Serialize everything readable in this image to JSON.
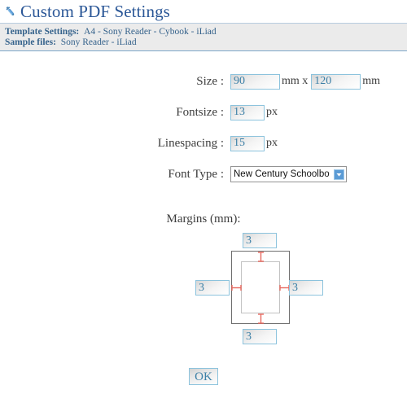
{
  "header": {
    "icon": "wrench-icon",
    "title": "Custom PDF Settings"
  },
  "info": {
    "templates_label": "Template Settings:",
    "templates": [
      "A4",
      "Sony Reader",
      "Cybook",
      "iLiad"
    ],
    "samples_label": "Sample files:",
    "samples": [
      "Sony Reader",
      "iLiad"
    ],
    "separator": " - "
  },
  "form": {
    "size": {
      "label": "Size :",
      "width_value": "90",
      "unit_mid": "mm x",
      "height_value": "120",
      "unit_end": "mm"
    },
    "fontsize": {
      "label": "Fontsize :",
      "value": "13",
      "unit": "px"
    },
    "linespacing": {
      "label": "Linespacing :",
      "value": "15",
      "unit": "px"
    },
    "fonttype": {
      "label": "Font Type :",
      "selected": "New Century Schoolbook",
      "options": [
        "New Century Schoolbook"
      ]
    }
  },
  "margins": {
    "title": "Margins (mm):",
    "top": "3",
    "right": "3",
    "bottom": "3",
    "left": "3"
  },
  "actions": {
    "ok_label": "OK"
  },
  "colors": {
    "title_blue": "#2b5797",
    "link_blue": "#36638c",
    "input_border": "#8cc3dd",
    "input_text": "#3b7fa6",
    "arrow_red": "#e8695f",
    "band_bg": "#ebebeb"
  }
}
